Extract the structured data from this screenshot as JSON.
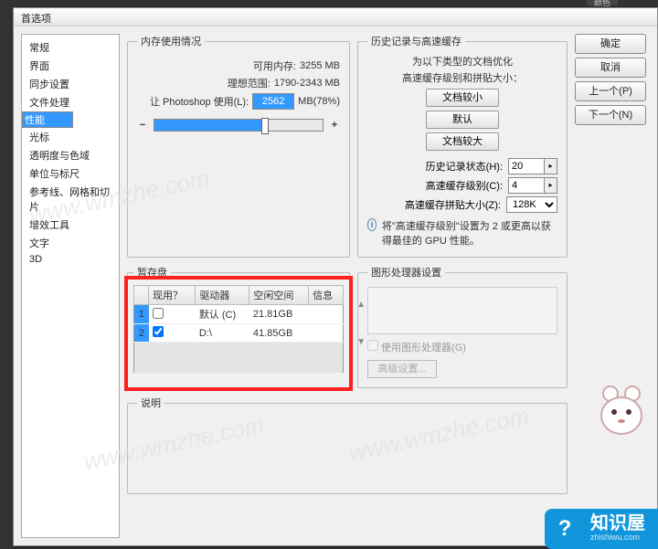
{
  "top_tab": "颜色",
  "dialog_title": "首选项",
  "sidebar": [
    "常规",
    "界面",
    "同步设置",
    "文件处理",
    "性能",
    "光标",
    "透明度与色域",
    "单位与标尺",
    "参考线、网格和切片",
    "增效工具",
    "文字",
    "3D"
  ],
  "sidebar_selected": 4,
  "buttons": {
    "ok": "确定",
    "cancel": "取消",
    "prev": "上一个(P)",
    "next": "下一个(N)"
  },
  "memory": {
    "legend": "内存使用情况",
    "available_label": "可用内存:",
    "available": "3255 MB",
    "ideal_label": "理想范围:",
    "ideal": "1790-2343 MB",
    "ps_label": "让 Photoshop 使用(L):",
    "ps_value": "2562",
    "ps_suffix": "MB(78%)"
  },
  "history": {
    "legend": "历史记录与高速缓存",
    "tip1": "为以下类型的文档优化",
    "tip2": "高速缓存级别和拼贴大小：",
    "small": "文档较小",
    "default": "默认",
    "big": "文档较大",
    "states_label": "历史记录状态(H):",
    "states": "20",
    "levels_label": "高速缓存级别(C):",
    "levels": "4",
    "tile_label": "高速缓存拼贴大小(Z):",
    "tile": "128K",
    "note": "将\"高速缓存级别\"设置为 2 或更高以获得最佳的 GPU 性能。"
  },
  "scratch": {
    "legend": "暂存盘",
    "cols": [
      "现用？",
      "驱动器",
      "空闲空间",
      "信息"
    ],
    "rows": [
      {
        "n": "1",
        "active": false,
        "drive": "默认 (C)",
        "free": "21.81GB",
        "info": ""
      },
      {
        "n": "2",
        "active": true,
        "drive": "D:\\",
        "free": "41.85GB",
        "info": ""
      }
    ]
  },
  "gpu": {
    "legend": "图形处理器设置",
    "use": "使用图形处理器(G)",
    "adv": "高级设置..."
  },
  "desc_legend": "说明",
  "watermark": "www.wmzhe.com",
  "badge": {
    "main": "知识屋",
    "sub": "zhishiwu.com"
  }
}
